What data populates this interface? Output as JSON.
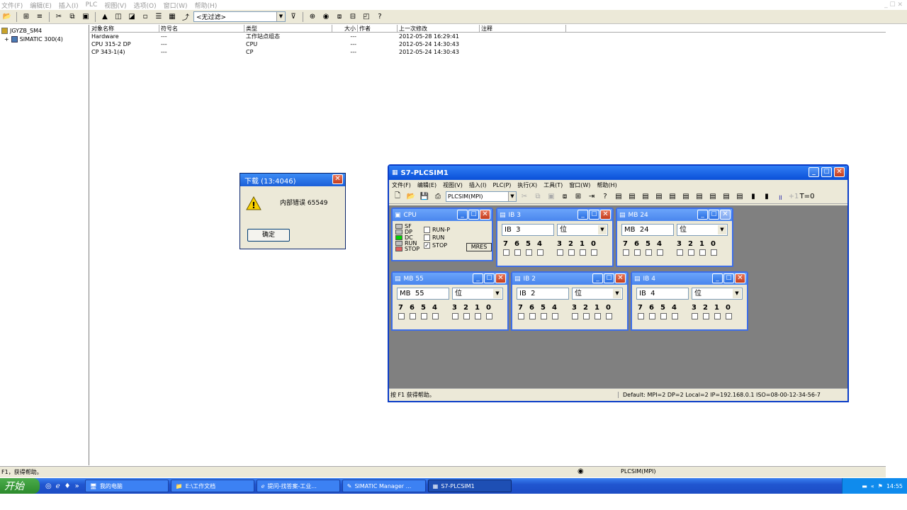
{
  "manager": {
    "menu": [
      "文件(F)",
      "编辑(E)",
      "插入(I)",
      "PLC",
      "视图(V)",
      "选项(O)",
      "窗口(W)",
      "帮助(H)"
    ],
    "window_controls": "_ ☐ ✕",
    "filter_value": "<无过滤>",
    "tree": {
      "project": "JGYZB_SM4",
      "station": "SIMATIC 300(4)"
    },
    "columns": [
      "对象名称",
      "符号名",
      "类型",
      "大小",
      "作者",
      "上一次修改",
      "注释"
    ],
    "rows": [
      {
        "name": "Hardware",
        "symbol": "---",
        "type": "工作站点组态",
        "size": "---",
        "author": "",
        "modified": "2012-05-28 16:29:41",
        "comment": ""
      },
      {
        "name": "CPU 315-2 DP",
        "symbol": "---",
        "type": "CPU",
        "size": "---",
        "author": "",
        "modified": "2012-05-24 14:30:43",
        "comment": ""
      },
      {
        "name": "CP 343-1(4)",
        "symbol": "---",
        "type": "CP",
        "size": "---",
        "author": "",
        "modified": "2012-05-24 14:30:43",
        "comment": ""
      }
    ],
    "status_left": "F1，获得帮助。",
    "status_right": "PLCSIM(MPI)"
  },
  "dialog": {
    "title": "下载  (13:4046)",
    "message": "内部错误 65549",
    "ok_label": "确定"
  },
  "plcsim": {
    "title": "S7-PLCSIM1",
    "menu": [
      "文件(F)",
      "编辑(E)",
      "视图(V)",
      "插入(I)",
      "PLC(P)",
      "执行(X)",
      "工具(T)",
      "窗口(W)",
      "帮助(H)"
    ],
    "connection": "PLCSIM(MPI)",
    "status_left": "按 F1 获得帮助。",
    "status_right": "Default:  MPI=2 DP=2 Local=2 IP=192.168.0.1 ISO=08-00-12-34-56-7",
    "cpu": {
      "title": "CPU",
      "leds": [
        "SF",
        "DP",
        "DC",
        "RUN",
        "STOP"
      ],
      "modes": [
        {
          "label": "RUN-P",
          "checked": false
        },
        {
          "label": "RUN",
          "checked": false
        },
        {
          "label": "STOP",
          "checked": true
        }
      ],
      "mres_label": "MRES"
    },
    "bit_labels": [
      "7",
      "6",
      "5",
      "4",
      "3",
      "2",
      "1",
      "0"
    ],
    "format_label": "位",
    "windows": [
      {
        "title": "IB     3",
        "area": "IB",
        "address": "3"
      },
      {
        "title": "MB     24",
        "area": "MB",
        "address": "24"
      },
      {
        "title": "MB     55",
        "area": "MB",
        "address": "55"
      },
      {
        "title": "IB     2",
        "area": "IB",
        "address": "2"
      },
      {
        "title": "IB     4",
        "area": "IB",
        "address": "4"
      }
    ]
  },
  "taskbar": {
    "start_label": "开始",
    "buttons": [
      "我的电脑",
      "E:\\工作文档",
      "提问-找答案-工业...",
      "SIMATIC Manager ...",
      "S7-PLCSIM1"
    ],
    "clock": "14:55"
  }
}
